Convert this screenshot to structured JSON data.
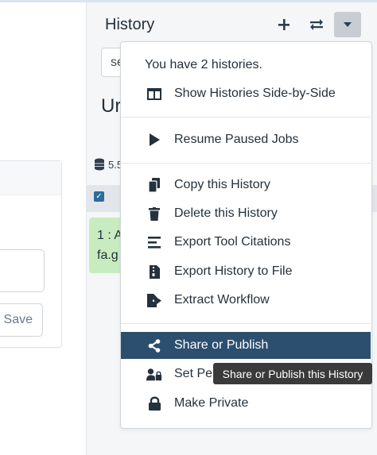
{
  "left": {
    "save_label": "Save"
  },
  "history_panel": {
    "title": "History",
    "buttons": [
      "plus-icon",
      "exchange-icon",
      "caret-down-icon"
    ],
    "search_value": "se",
    "history_name": "Ur",
    "size": "5.5",
    "dataset_title": "1 : A",
    "dataset_file": "fa.g"
  },
  "menu": {
    "header": "You have 2 histories.",
    "items": [
      {
        "label": "Show Histories Side-by-Side",
        "icon": "columns-icon"
      },
      {
        "label": "Resume Paused Jobs",
        "icon": "play-icon"
      },
      {
        "label": "Copy this History",
        "icon": "copy-icon"
      },
      {
        "label": "Delete this History",
        "icon": "trash-icon"
      },
      {
        "label": "Export Tool Citations",
        "icon": "list-icon"
      },
      {
        "label": "Export History to File",
        "icon": "file-archive-icon"
      },
      {
        "label": "Extract Workflow",
        "icon": "file-export-icon"
      },
      {
        "label": "Share or Publish",
        "icon": "share-icon"
      },
      {
        "label": "Set Pe",
        "icon": "user-lock-icon"
      },
      {
        "label": "Make Private",
        "icon": "lock-icon"
      }
    ]
  },
  "tooltip": "Share or Publish this History",
  "colors": {
    "menu_active": "#2c4f6f",
    "dataset_ok": "#c8ecbf",
    "tooltip_bg": "#3a3a3a"
  }
}
